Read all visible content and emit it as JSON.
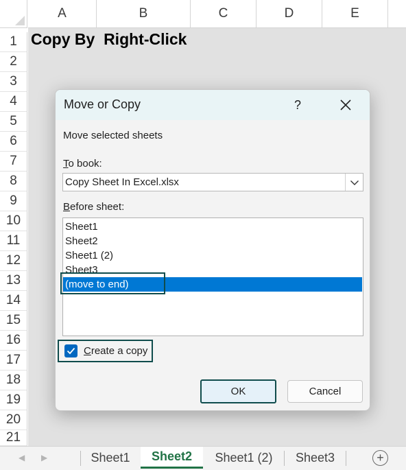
{
  "spreadsheet": {
    "columns": [
      "A",
      "B",
      "C",
      "D",
      "E"
    ],
    "rows": [
      "1",
      "2",
      "3",
      "4",
      "5",
      "6",
      "7",
      "8",
      "9",
      "10",
      "11",
      "12",
      "13",
      "14",
      "15",
      "16",
      "17",
      "18",
      "19",
      "20",
      "21"
    ],
    "cell_a1": "Copy By  Right-Click"
  },
  "dialog": {
    "title": "Move or Copy",
    "help_label": "?",
    "instruction": "Move selected sheets",
    "to_book_label_hotkey": "T",
    "to_book_label_rest": "o book:",
    "to_book_value": "Copy Sheet In Excel.xlsx",
    "before_sheet_label_hotkey": "B",
    "before_sheet_label_rest": "efore sheet:",
    "before_sheet_items": [
      "Sheet1",
      "Sheet2",
      "Sheet1 (2)",
      "Sheet3",
      "(move to end)"
    ],
    "selected_item": "(move to end)",
    "create_copy_hotkey": "C",
    "create_copy_rest": "reate a copy",
    "create_copy_checked": true,
    "ok_label": "OK",
    "cancel_label": "Cancel",
    "selection_color": "#0078d4",
    "highlight_color": "#0f4c4c"
  },
  "sheet_tabs": {
    "tabs": [
      "Sheet1",
      "Sheet2",
      "Sheet1 (2)",
      "Sheet3"
    ],
    "active": "Sheet2",
    "active_color": "#217346",
    "add_icon": "plus-icon",
    "add_label": "+"
  }
}
